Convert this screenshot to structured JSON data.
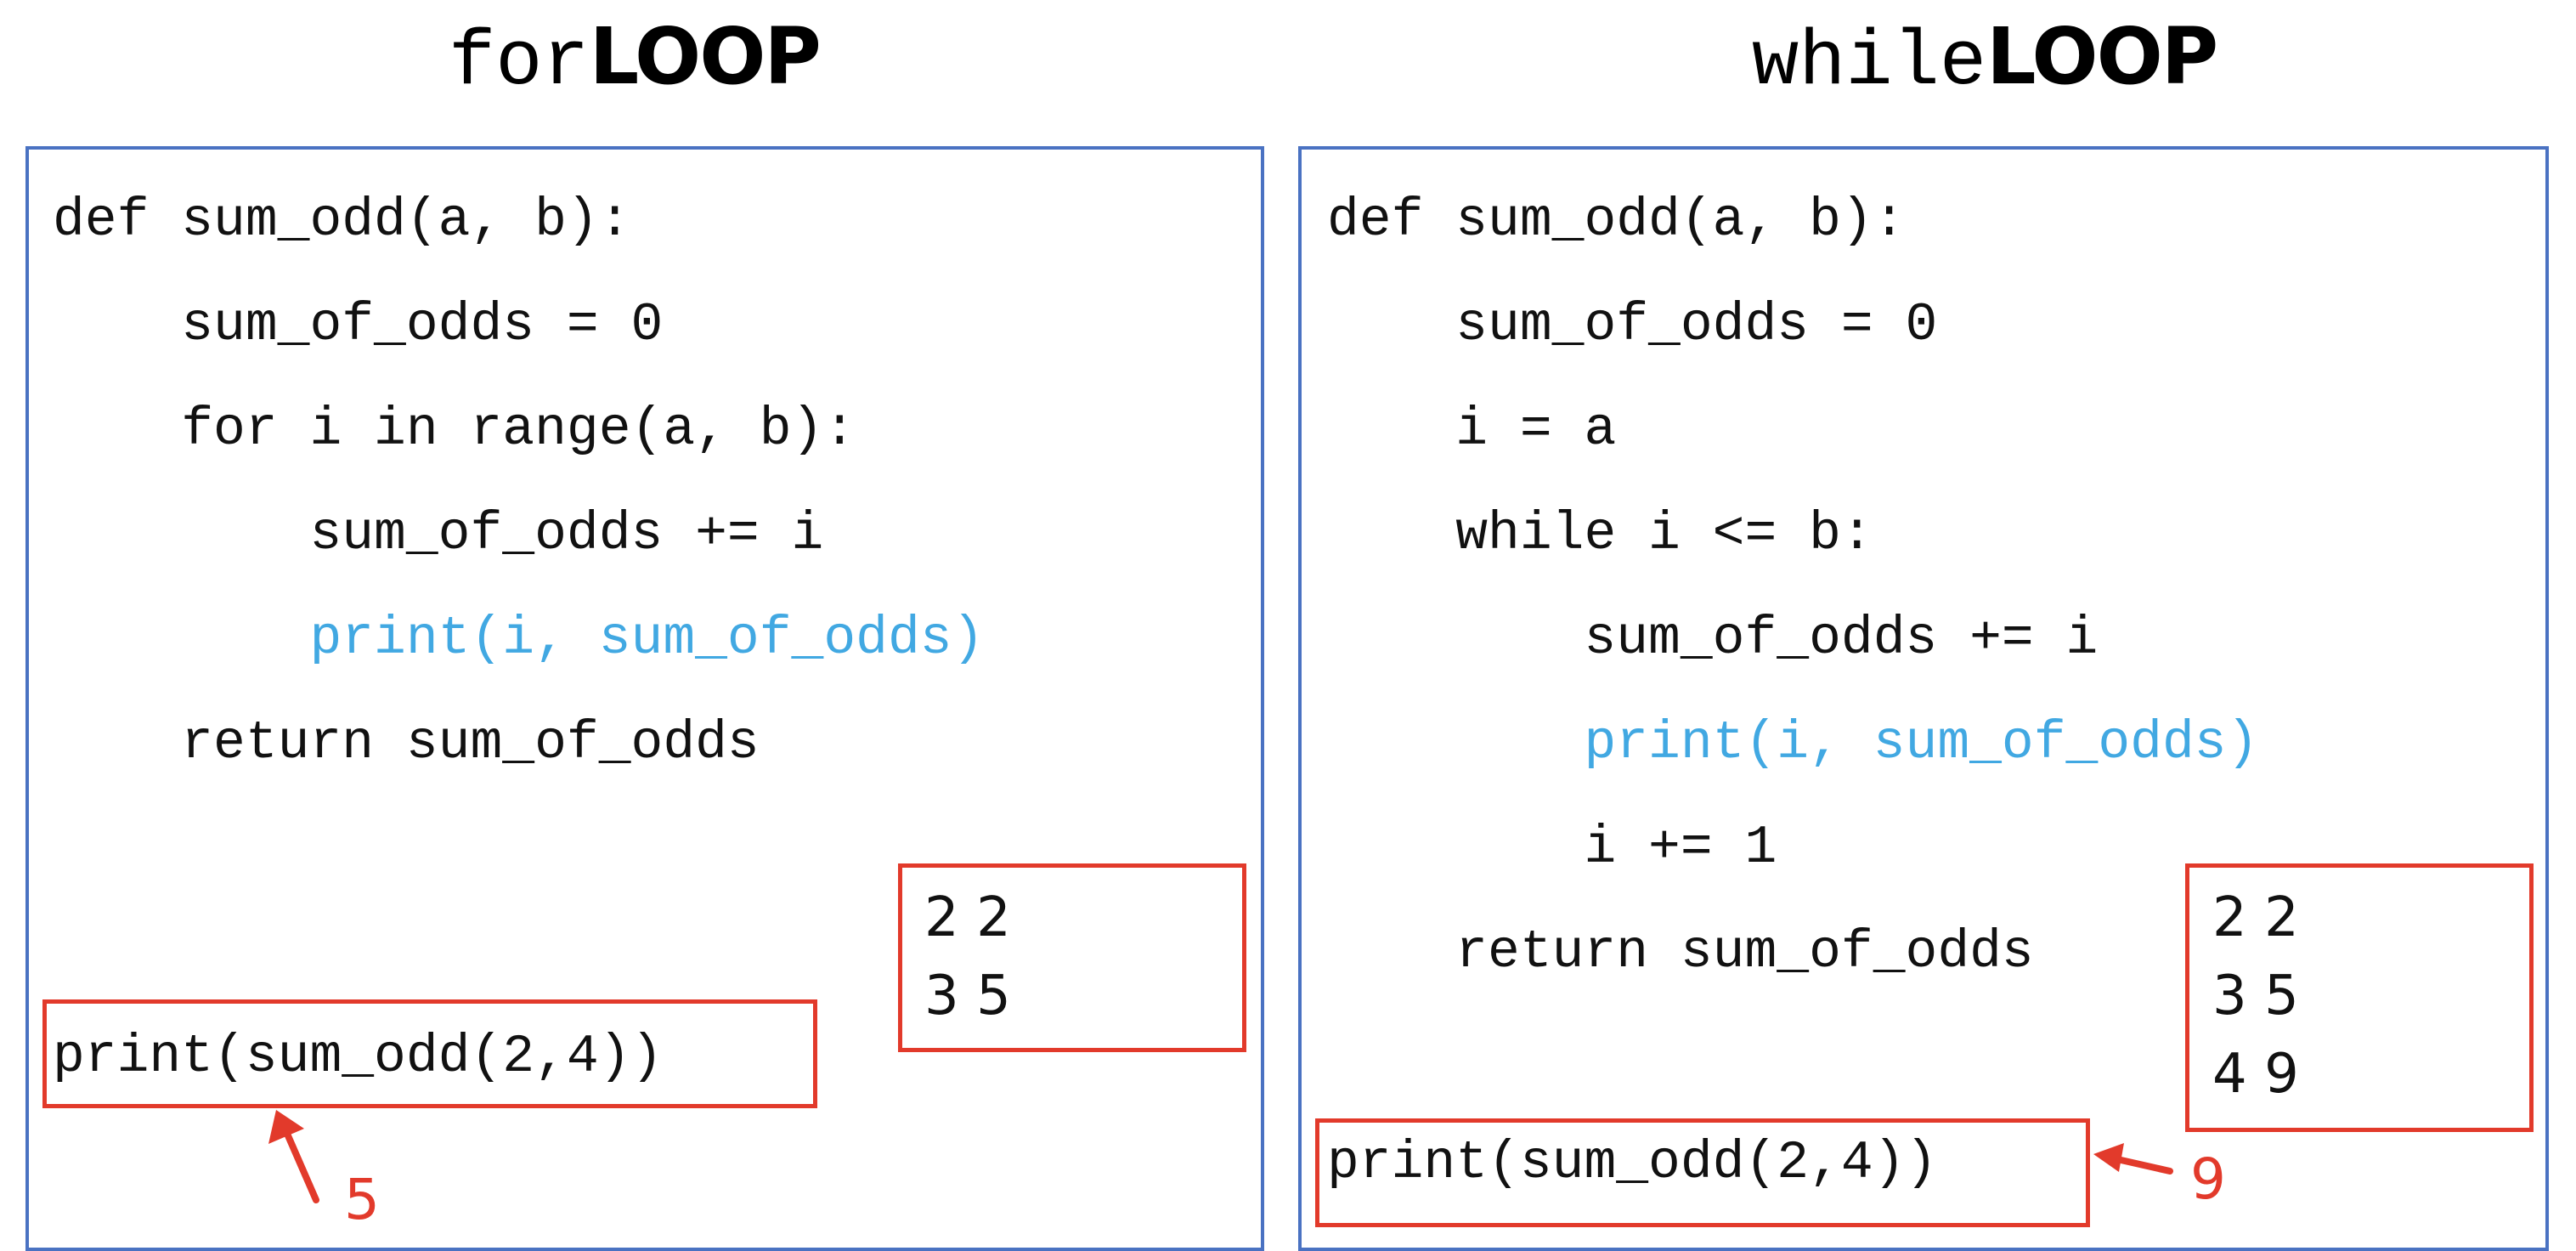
{
  "headings": {
    "left": {
      "keyword": "for",
      "word": "LOOP"
    },
    "right": {
      "keyword": "while",
      "word": "LOOP"
    }
  },
  "left_panel": {
    "code": [
      "def sum_odd(a, b):",
      "    sum_of_odds = 0",
      "    for i in range(a, b):",
      "        sum_of_odds += i",
      "        print(i, sum_of_odds)",
      "    return sum_of_odds"
    ],
    "output": "2 2\n3 5",
    "call": "print(sum_odd(2,4))",
    "result": "5"
  },
  "right_panel": {
    "code": [
      "def sum_odd(a, b):",
      "    sum_of_odds = 0",
      "    i = a",
      "    while i <= b:",
      "        sum_of_odds += i",
      "        print(i, sum_of_odds)",
      "        i += 1",
      "    return sum_of_odds"
    ],
    "output": "2 2\n3 5\n4 9",
    "call": "print(sum_odd(2,4))",
    "result": "9"
  },
  "colors": {
    "panel_border": "#4a72c2",
    "highlight_red": "#e23a2b",
    "print_blue": "#41a8e2"
  }
}
